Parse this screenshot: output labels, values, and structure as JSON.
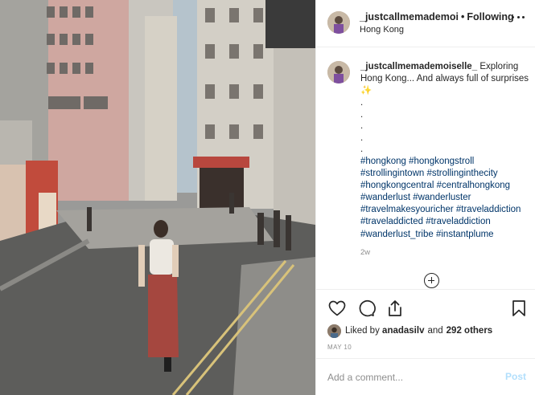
{
  "post": {
    "username": "_justcallmemademoi",
    "separator": "•",
    "follow_state": "Following",
    "location": "Hong Kong"
  },
  "caption": {
    "username": "_justcallmemademoiselle_",
    "text": "Exploring Hong Kong... And always full of surprises",
    "sparkle": "✨",
    "dots": [
      ".",
      ".",
      ".",
      ".",
      "."
    ],
    "hashtag_lines": [
      "#hongkong #hongkongstroll",
      "#strollingintown #strollinginthecity",
      "#hongkongcentral #centralhongkong",
      "#wanderlust #wanderluster",
      "#travelmakesyouricher #traveladdiction",
      "#traveladdicted #traveladdiction",
      "#wanderlust_tribe #instantplume"
    ],
    "time_ago": "2w"
  },
  "actions": {
    "like_icon": "heart-icon",
    "comment_icon": "comment-icon",
    "share_icon": "share-icon",
    "save_icon": "bookmark-icon"
  },
  "likes": {
    "prefix": "Liked by",
    "user": "anadasilv",
    "conjunction": "and",
    "others": "292 others"
  },
  "date": "MAY 10",
  "comment": {
    "placeholder": "Add a comment...",
    "value": "",
    "post_label": "Post"
  },
  "colors": {
    "text": "#262626",
    "secondary": "#8e8e8e",
    "hashtag": "#003569",
    "post_disabled": "#b2dffc",
    "border": "#efefef"
  }
}
